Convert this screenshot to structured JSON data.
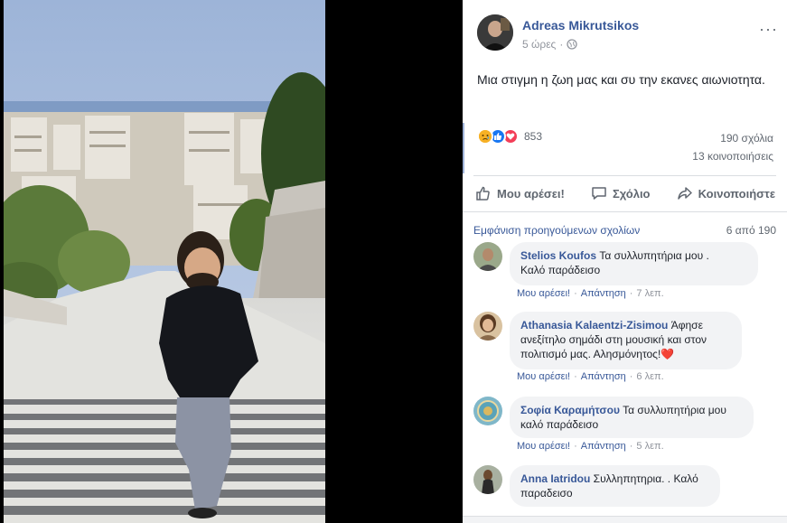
{
  "post": {
    "author": "Adreas Mikrutsikos",
    "time": "5 ώρες",
    "dot": "·",
    "text": "Μια στιγμη η ζωη μας και συ την εκανες αιωνιοτητα.",
    "reactions_count": "853",
    "comments_count": "190 σχόλια",
    "shares_count": "13 κοινοποιήσεις",
    "more": "···"
  },
  "actions": {
    "like": "Μου αρέσει!",
    "comment": "Σχόλιο",
    "share": "Κοινοποιήστε"
  },
  "comments_header": {
    "previous": "Εμφάνιση προηγούμενων σχολίων",
    "count": "6 από 190"
  },
  "comments": [
    {
      "name": "Stelios Koufos",
      "text": " Τα συλλυπητήρια μου .",
      "text2": "Καλό παράδεισο",
      "like": "Μου αρέσει!",
      "reply": "Απάντηση",
      "time": "7 λεπ."
    },
    {
      "name": "Athanasia Kalaentzi-Zisimou",
      "text": " Άφησε",
      "text2": "ανεξίτηλο σημάδι στη μουσική και στον",
      "text3": "πολιτισμό μας. Αλησμόνητος!",
      "emoji": "❤️",
      "like": "Μου αρέσει!",
      "reply": "Απάντηση",
      "time": "6 λεπ."
    },
    {
      "name": "Σοφία Καραμήτσου",
      "text": " Τα συλλυπητήρια μου",
      "text2": "καλό παράδεισο",
      "like": "Μου αρέσει!",
      "reply": "Απάντηση",
      "time": "5 λεπ."
    },
    {
      "name": "Anna Iatridou",
      "text": " Συλληπητηρια. . Καλό",
      "text2": "παραδεισο"
    }
  ],
  "colors": {
    "link": "#385898",
    "like_blue": "#1877f2",
    "love_red": "#f33e58",
    "sad_yellow": "#f7b125"
  }
}
